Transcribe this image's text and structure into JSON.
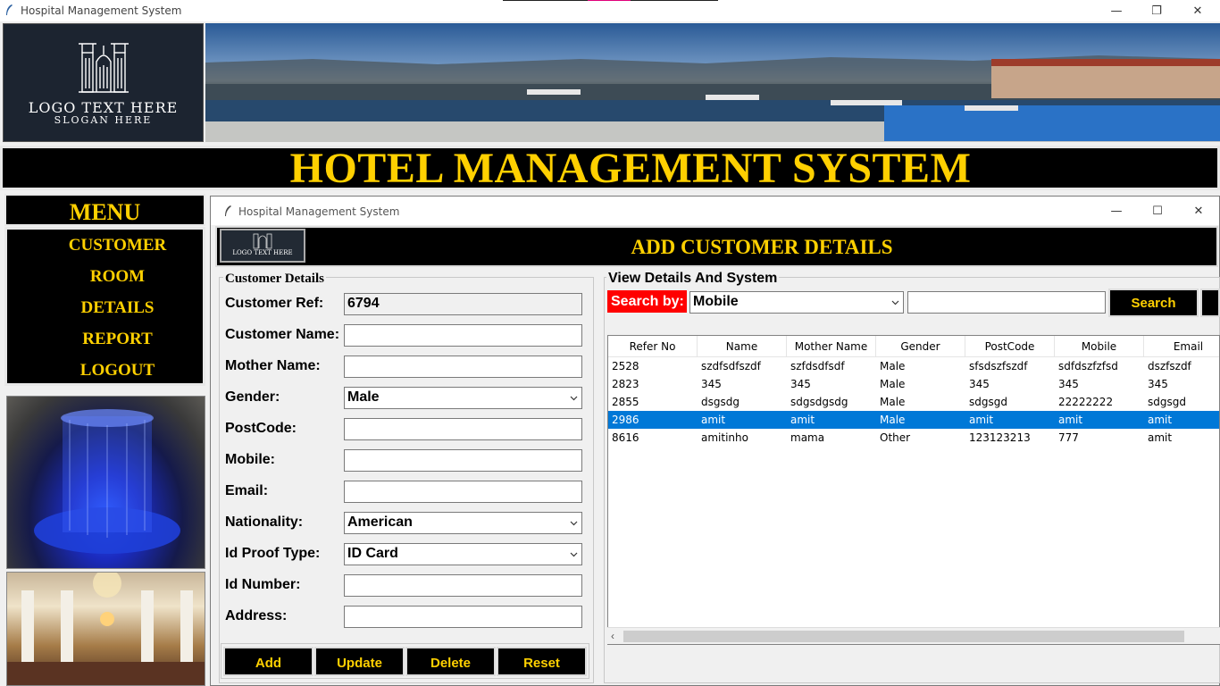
{
  "window": {
    "title": "Hospital Management System",
    "minimize": "—",
    "restore": "❐",
    "close": "✕"
  },
  "logo": {
    "line1": "LOGO TEXT HERE",
    "line2": "SLOGAN HERE"
  },
  "header": {
    "title": "HOTEL MANAGEMENT SYSTEM"
  },
  "menu": {
    "title": "MENU",
    "items": [
      {
        "label": "CUSTOMER"
      },
      {
        "label": "ROOM"
      },
      {
        "label": "DETAILS"
      },
      {
        "label": "REPORT"
      },
      {
        "label": "LOGOUT"
      }
    ]
  },
  "inner_window": {
    "title": "Hospital Management System",
    "minimize": "—",
    "maximize": "☐",
    "close": "✕",
    "heading": "ADD CUSTOMER DETAILS"
  },
  "form": {
    "legend": "Customer Details",
    "fields": {
      "ref": {
        "label": "Customer Ref:",
        "value": "6794"
      },
      "name": {
        "label": "Customer Name:",
        "value": ""
      },
      "mother": {
        "label": "Mother Name:",
        "value": ""
      },
      "gender": {
        "label": "Gender:",
        "value": "Male"
      },
      "postcode": {
        "label": "PostCode:",
        "value": ""
      },
      "mobile": {
        "label": "Mobile:",
        "value": ""
      },
      "email": {
        "label": "Email:",
        "value": ""
      },
      "nationality": {
        "label": "Nationality:",
        "value": "American"
      },
      "idproof": {
        "label": "Id Proof Type:",
        "value": "ID Card"
      },
      "idnumber": {
        "label": "Id Number:",
        "value": ""
      },
      "address": {
        "label": "Address:",
        "value": ""
      }
    },
    "buttons": {
      "add": "Add",
      "update": "Update",
      "delete": "Delete",
      "reset": "Reset"
    }
  },
  "view": {
    "legend": "View Details And System",
    "search_label": "Search by:",
    "search_by": "Mobile",
    "search_text": "",
    "search_button": "Search",
    "table": {
      "columns": [
        "Refer No",
        "Name",
        "Mother Name",
        "Gender",
        "PostCode",
        "Mobile",
        "Email"
      ],
      "rows": [
        [
          "2528",
          "szdfsdfszdf",
          "szfdsdfsdf",
          "Male",
          "sfsdszfszdf",
          "sdfdszfzfsd",
          "dszfszdf"
        ],
        [
          "2823",
          "345",
          "345",
          "Male",
          "345",
          "345",
          "345"
        ],
        [
          "2855",
          "dsgsdg",
          "sdgsdgsdg",
          "Male",
          "sdgsgd",
          "22222222",
          "sdgsgd"
        ],
        [
          "2986",
          "amit",
          "amit",
          "Male",
          "amit",
          "amit",
          "amit"
        ],
        [
          "8616",
          "amitinho",
          "mama",
          "Other",
          "123123213",
          "777",
          "amit"
        ]
      ],
      "selected_row": 3
    }
  },
  "colors": {
    "accent": "#ffd000",
    "panel": "#000000",
    "search_label_bg": "#ff0000",
    "selection": "#0078d7"
  }
}
